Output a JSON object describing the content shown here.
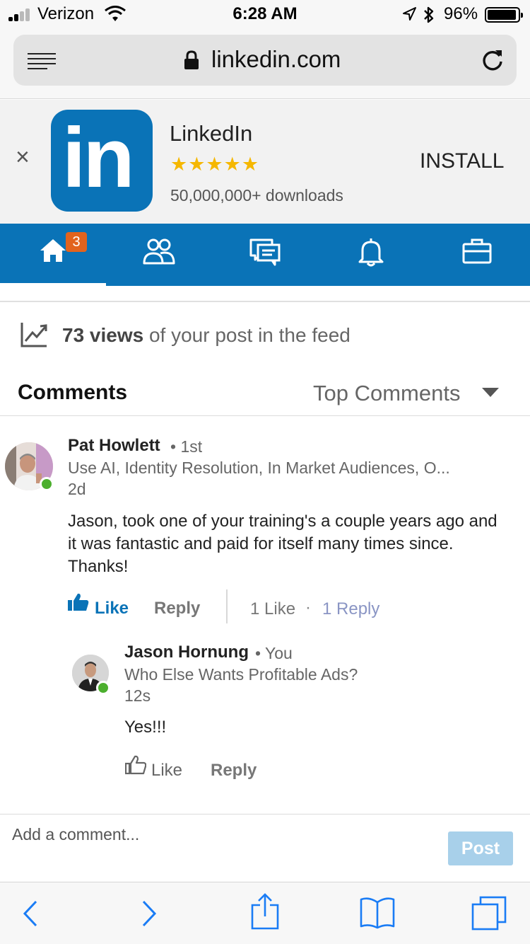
{
  "status_bar": {
    "carrier": "Verizon",
    "time": "6:28 AM",
    "battery_percent": "96%",
    "signal_bars_active": 2
  },
  "browser": {
    "url": "linkedin.com"
  },
  "app_banner": {
    "app_name": "LinkedIn",
    "logo_text": "in",
    "rating": "★★★★★",
    "downloads": "50,000,000+ downloads",
    "install_label": "INSTALL",
    "close_label": "×"
  },
  "nav": {
    "home_badge": "3",
    "items": [
      "home-icon",
      "my-network-icon",
      "messaging-icon",
      "notifications-icon",
      "jobs-icon"
    ]
  },
  "views": {
    "count_text": "73 views",
    "rest_text": " of your post in the feed"
  },
  "comments_header": {
    "title": "Comments",
    "sort_label": "Top Comments"
  },
  "comments": [
    {
      "name": "Pat Howlett",
      "degree": "• 1st",
      "headline": "Use AI, Identity Resolution, In Market Audiences, O...",
      "time": "2d",
      "body": "Jason, took one of your training's a couple years ago and it was fantastic and paid for itself many times since. Thanks!",
      "like_label": "Like",
      "reply_label": "Reply",
      "likes_count": "1 Like",
      "separator": "·",
      "replies_count": "1 Reply"
    },
    {
      "name": "Jason Hornung",
      "degree": "• You",
      "headline": "Who Else Wants Profitable Ads?",
      "time": "12s",
      "body": "Yes!!!",
      "like_label": "Like",
      "reply_label": "Reply"
    }
  ],
  "composer": {
    "placeholder": "Add a comment...",
    "post_label": "Post"
  },
  "colors": {
    "linkedin_blue": "#0a73b7",
    "badge_orange": "#e2631d",
    "star_gold": "#f5b700",
    "online_green": "#4caf2e",
    "ios_blue": "#1a7cf5"
  }
}
